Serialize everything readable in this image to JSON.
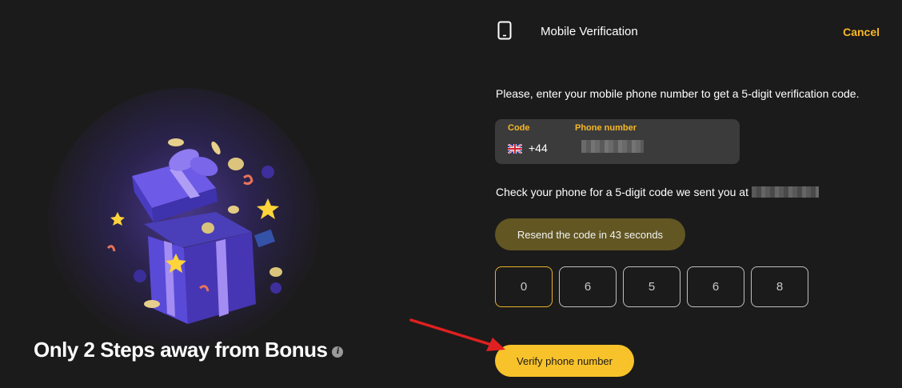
{
  "promo": {
    "title": "Only 2 Steps away from Bonus",
    "info_icon": "info-icon"
  },
  "header": {
    "icon": "mobile-phone-icon",
    "title": "Mobile Verification",
    "cancel_label": "Cancel"
  },
  "instruction": "Please, enter your mobile phone number to get a 5-digit verification code.",
  "phone_form": {
    "code_label": "Code",
    "number_label": "Phone number",
    "flag_icon": "uk-flag-icon",
    "dial_code": "+44",
    "number_value": "•••••••"
  },
  "check_text": "Check your phone for a 5-digit code we sent you at",
  "masked_phone": "•••••••",
  "resend_label": "Resend the code in 43 seconds",
  "otp_digits": [
    "0",
    "6",
    "5",
    "6",
    "8"
  ],
  "verify_label": "Verify phone number",
  "colors": {
    "background": "#1c1b1b",
    "accent": "#f8c32a",
    "cancel": "#f7b826",
    "resend_bg": "#665a24",
    "arrow": "#e02020"
  }
}
